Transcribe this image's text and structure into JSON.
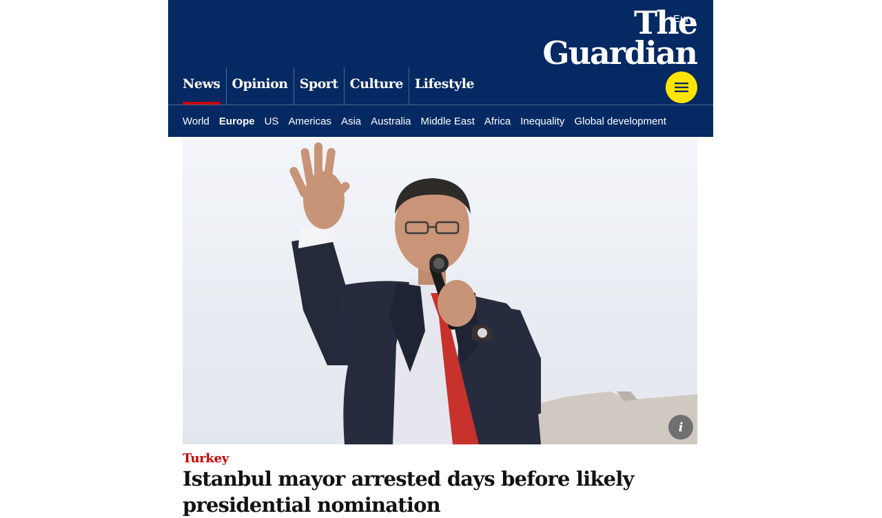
{
  "header": {
    "edition": "Eur",
    "logo_line1": "The",
    "logo_line2": "Guardian",
    "colors": {
      "brand": "#052962",
      "accent": "#c70000",
      "menu": "#ffe500"
    }
  },
  "pillars": [
    {
      "label": "News",
      "active": true
    },
    {
      "label": "Opinion"
    },
    {
      "label": "Sport"
    },
    {
      "label": "Culture"
    },
    {
      "label": "Lifestyle"
    }
  ],
  "subnav": [
    {
      "label": "World"
    },
    {
      "label": "Europe",
      "bold": true
    },
    {
      "label": "US"
    },
    {
      "label": "Americas"
    },
    {
      "label": "Asia"
    },
    {
      "label": "Australia"
    },
    {
      "label": "Middle East"
    },
    {
      "label": "Africa"
    },
    {
      "label": "Inequality"
    },
    {
      "label": "Global development"
    }
  ],
  "hero": {
    "info_label": "i"
  },
  "article": {
    "kicker": "Turkey",
    "headline": "Istanbul mayor arrested days before likely presidential nomination"
  }
}
